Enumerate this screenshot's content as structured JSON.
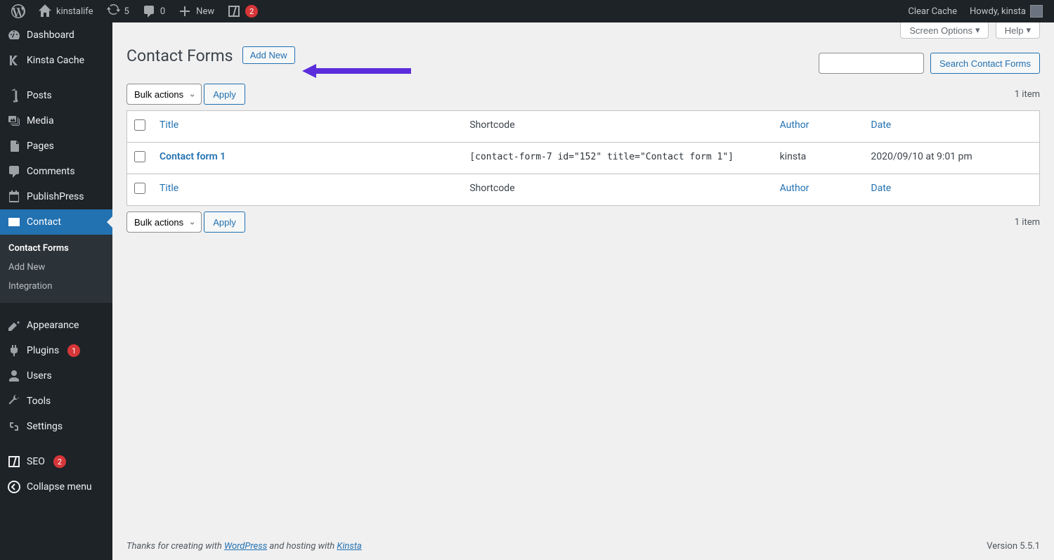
{
  "admin_bar": {
    "site_name": "kinstalife",
    "updates_count": "5",
    "comments_count": "0",
    "new_label": "New",
    "yoast_badge": "2",
    "clear_cache": "Clear Cache",
    "howdy": "Howdy, kinsta"
  },
  "sidebar": {
    "items": [
      {
        "label": "Dashboard",
        "icon": "dashboard-icon"
      },
      {
        "label": "Kinsta Cache",
        "icon": "kinsta-icon"
      },
      {
        "label": "Posts",
        "icon": "posts-icon"
      },
      {
        "label": "Media",
        "icon": "media-icon"
      },
      {
        "label": "Pages",
        "icon": "pages-icon"
      },
      {
        "label": "Comments",
        "icon": "comments-icon"
      },
      {
        "label": "PublishPress",
        "icon": "calendar-icon"
      },
      {
        "label": "Contact",
        "icon": "mail-icon"
      }
    ],
    "submenu": [
      {
        "label": "Contact Forms"
      },
      {
        "label": "Add New"
      },
      {
        "label": "Integration"
      }
    ],
    "items2": [
      {
        "label": "Appearance",
        "icon": "appearance-icon"
      },
      {
        "label": "Plugins",
        "icon": "plugins-icon",
        "badge": "1"
      },
      {
        "label": "Users",
        "icon": "users-icon"
      },
      {
        "label": "Tools",
        "icon": "tools-icon"
      },
      {
        "label": "Settings",
        "icon": "settings-icon"
      }
    ],
    "items3": [
      {
        "label": "SEO",
        "icon": "seo-icon",
        "badge": "2"
      },
      {
        "label": "Collapse menu",
        "icon": "collapse-icon"
      }
    ]
  },
  "screen_meta": {
    "options": "Screen Options",
    "help": "Help"
  },
  "header": {
    "title": "Contact Forms",
    "add_new": "Add New"
  },
  "search": {
    "button": "Search Contact Forms"
  },
  "bulk": {
    "label": "Bulk actions",
    "apply": "Apply"
  },
  "paging": {
    "count": "1 item"
  },
  "table": {
    "columns": {
      "title": "Title",
      "shortcode": "Shortcode",
      "author": "Author",
      "date": "Date"
    },
    "rows": [
      {
        "title": "Contact form 1",
        "shortcode": "[contact-form-7 id=\"152\" title=\"Contact form 1\"]",
        "author": "kinsta",
        "date": "2020/09/10 at 9:01 pm"
      }
    ]
  },
  "footer": {
    "thanks_prefix": "Thanks for creating with ",
    "wordpress": "WordPress",
    "hosting_mid": " and hosting with ",
    "kinsta": "Kinsta",
    "version": "Version 5.5.1"
  }
}
